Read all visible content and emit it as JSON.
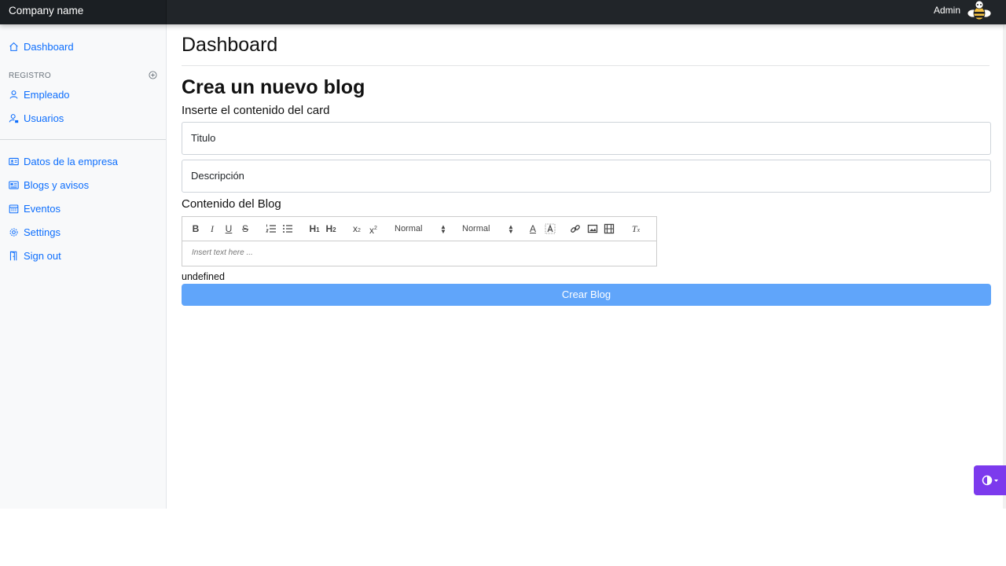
{
  "header": {
    "brand": "Company name",
    "user": "Admin"
  },
  "sidebar": {
    "items_top": [
      {
        "label": "Dashboard",
        "icon": "house-icon"
      }
    ],
    "section_heading": "REGISTRO",
    "items_registro": [
      {
        "label": "Empleado",
        "icon": "person-icon"
      },
      {
        "label": "Usuarios",
        "icon": "person-lock-icon"
      }
    ],
    "items_bottom": [
      {
        "label": "Datos de la empresa",
        "icon": "person-vcard-icon"
      },
      {
        "label": "Blogs y avisos",
        "icon": "newspaper-icon"
      },
      {
        "label": "Eventos",
        "icon": "calendar-icon"
      },
      {
        "label": "Settings",
        "icon": "gear-icon"
      },
      {
        "label": "Sign out",
        "icon": "door-icon"
      }
    ]
  },
  "main": {
    "page_title": "Dashboard",
    "form_title": "Crea un nuevo blog",
    "card_subtitle": "Inserte el contenido del card",
    "title_placeholder": "Titulo",
    "description_placeholder": "Descripción",
    "content_label": "Contenido del Blog",
    "editor": {
      "font_size_picker": "Normal",
      "header_picker": "Normal",
      "placeholder": "Insert text here ..."
    },
    "status_text": "undefined",
    "submit_label": "Crear Blog"
  },
  "colors": {
    "accent": "#0d6efd",
    "submit": "#60a5fa",
    "topbar": "#212529",
    "theme_toggle": "#7c3aed"
  }
}
